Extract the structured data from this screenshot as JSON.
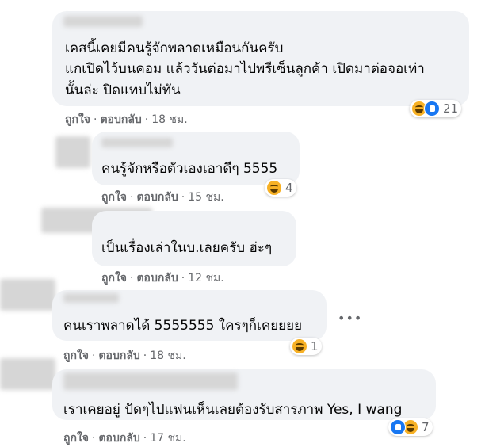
{
  "comments": [
    {
      "lines": [
        "เคสนี้เคยมีคนรู้จักพลาดเหมือนกันครับ",
        "แกเปิดไว้บนคอม แล้ววันต่อมาไปพรีเซ็นลูกค้า เปิดมาต่อจอเท่า",
        "นั้นล่ะ ปิดแทบไม่ทัน"
      ],
      "like_label": "ถูกใจ",
      "reply_label": "ตอบกลับ",
      "time": "18 ชม.",
      "reactions": [
        "haha",
        "like"
      ],
      "reaction_count": "21"
    },
    {
      "lines": [
        "คนรู้จักหรือตัวเองเอาดีๆ 5555"
      ],
      "like_label": "ถูกใจ",
      "reply_label": "ตอบกลับ",
      "time": "15 ชม.",
      "reactions": [
        "haha"
      ],
      "reaction_count": "4"
    },
    {
      "lines": [
        "เป็นเรื่องเล่าในบ.เลยครับ ฮ่ะๆ"
      ],
      "like_label": "ถูกใจ",
      "reply_label": "ตอบกลับ",
      "time": "12 ชม."
    },
    {
      "lines": [
        "คนเราพลาดได้ 5555555 ใครๆก็เคยยยย"
      ],
      "like_label": "ถูกใจ",
      "reply_label": "ตอบกลับ",
      "time": "18 ชม.",
      "reactions": [
        "haha"
      ],
      "reaction_count": "1",
      "more": "•••"
    },
    {
      "lines": [
        "เราเคยอยู่ ปัดๆไปแฟนเห็นเลยต้องรับสารภาพ Yes, I wang"
      ],
      "like_label": "ถูกใจ",
      "reply_label": "ตอบกลับ",
      "time": "17 ชม.",
      "reactions": [
        "like",
        "haha"
      ],
      "reaction_count": "7"
    }
  ],
  "colors": {
    "bubble": "#f0f2f5",
    "meta": "#65676b",
    "like": "#1877f2",
    "haha": "#f7b125"
  }
}
